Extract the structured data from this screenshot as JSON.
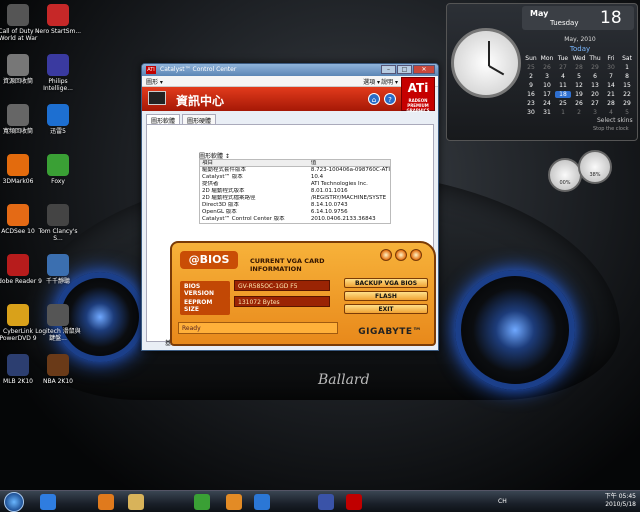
{
  "desktop": {
    "icons": [
      {
        "label": "Call of Duty - World at War",
        "color": "#555"
      },
      {
        "label": "Nero StartSm...",
        "color": "#c62828"
      },
      {
        "label": "資源回收筒",
        "color": "#777"
      },
      {
        "label": "Philips Intellige...",
        "color": "#3a3aa0"
      },
      {
        "label": "寬頻回收筒",
        "color": "#666"
      },
      {
        "label": "迅雷5",
        "color": "#1d6fd1"
      },
      {
        "label": "3DMark06",
        "color": "#e36b0d"
      },
      {
        "label": "Foxy",
        "color": "#3aa035"
      },
      {
        "label": "ACDSee 10",
        "color": "#e46a15"
      },
      {
        "label": "Tom Clancy's S...",
        "color": "#444"
      },
      {
        "label": "Adobe Reader 9",
        "color": "#b71c1c"
      },
      {
        "label": "千千靜聽",
        "color": "#3b6fb0"
      },
      {
        "label": "CyberLink PowerDVD 9",
        "color": "#d9a11a"
      },
      {
        "label": "Logitech 滑鼠與鍵盤...",
        "color": "#555"
      },
      {
        "label": "MLB 2K10",
        "color": "#2c3e70"
      },
      {
        "label": "NBA 2K10",
        "color": "#6a3a18"
      }
    ]
  },
  "gadgets": {
    "calendar": {
      "month": "May",
      "weekday": "Tuesday",
      "day": "18",
      "grid_title": "May, 2010",
      "today_label": "Today",
      "weekdays": [
        "Sun",
        "Mon",
        "Tue",
        "Wed",
        "Thu",
        "Fri",
        "Sat"
      ],
      "days": [
        "25",
        "26",
        "27",
        "28",
        "29",
        "30",
        "1",
        "2",
        "3",
        "4",
        "5",
        "6",
        "7",
        "8",
        "9",
        "10",
        "11",
        "12",
        "13",
        "14",
        "15",
        "16",
        "17",
        "18",
        "19",
        "20",
        "21",
        "22",
        "23",
        "24",
        "25",
        "26",
        "27",
        "28",
        "29",
        "30",
        "31",
        "1",
        "2",
        "3",
        "4",
        "5"
      ],
      "select_label": "Select skins",
      "status": "Stop the clock"
    },
    "meters": [
      {
        "name": "cpu-meter-icon",
        "value": "00%"
      },
      {
        "name": "ram-meter-icon",
        "value": "38%"
      }
    ]
  },
  "catalyst": {
    "window_title": "Catalyst™ Control Center",
    "menu_left": "圖形 ▾",
    "menu_right": "選項 ▾",
    "help_menu": "說明 ▾",
    "ati_brand": "ATi",
    "ati_sub": "RADEON PREMIUM GRAPHICS",
    "banner_title": "資訊中心",
    "tabs": [
      "圖形軟體",
      "圖形硬體"
    ],
    "group_label": "圖形軟體 ↕",
    "table_header": [
      "項目",
      "值"
    ],
    "rows": [
      [
        "驅動程式套件版本",
        "8.723-100406a-098760C-ATI"
      ],
      [
        "Catalyst™ 版本",
        "10.4"
      ],
      [
        "提供者",
        "ATI Technologies Inc."
      ],
      [
        "2D 驅動程式版本",
        "8.01.01.1016"
      ],
      [
        "2D 驅動程式檔案路徑",
        "/REGISTRY/MACHINE/SYSTE"
      ],
      [
        "Direct3D 版本",
        "8.14.10.0743"
      ],
      [
        "OpenGL 版本",
        "6.14.10.9756"
      ],
      [
        "Catalyst™ Control Center 版本",
        "2010.0406.2133.36843"
      ]
    ],
    "bottom_btn": "基"
  },
  "bios": {
    "logo": "@BIOS",
    "heading_line1": "CURRENT VGA CARD",
    "heading_line2": "INFORMATION",
    "bios_version_label": "BIOS VERSION",
    "bios_version_value": "GV-R585OC-1GD F5",
    "eeprom_label": "EEPROM SIZE",
    "eeprom_value": "131072  Bytes",
    "buttons": [
      "BACKUP VGA BIOS",
      "FLASH",
      "EXIT"
    ],
    "status": "Ready",
    "brand": "GIGABYTE™"
  },
  "taskbar": {
    "lang": "CH",
    "time": "下午 05:45",
    "date": "2010/5/18",
    "items": [
      {
        "name": "ie-taskbar-icon",
        "color": "#2f7de0"
      },
      {
        "name": "media-player-taskbar-icon",
        "color": "#e07a1d"
      },
      {
        "name": "explorer-taskbar-icon",
        "color": "#d8b35a"
      },
      {
        "name": "foxy-taskbar-icon",
        "color": "#3aa035"
      },
      {
        "name": "winamp-taskbar-icon",
        "color": "#e38b25"
      },
      {
        "name": "xunlei-taskbar-icon",
        "color": "#2b77d6"
      },
      {
        "name": "gigabyte-taskbar-icon",
        "color": "#3a53a8"
      },
      {
        "name": "ati-taskbar-icon",
        "color": "#c00000"
      }
    ]
  },
  "signature": "Ballard"
}
